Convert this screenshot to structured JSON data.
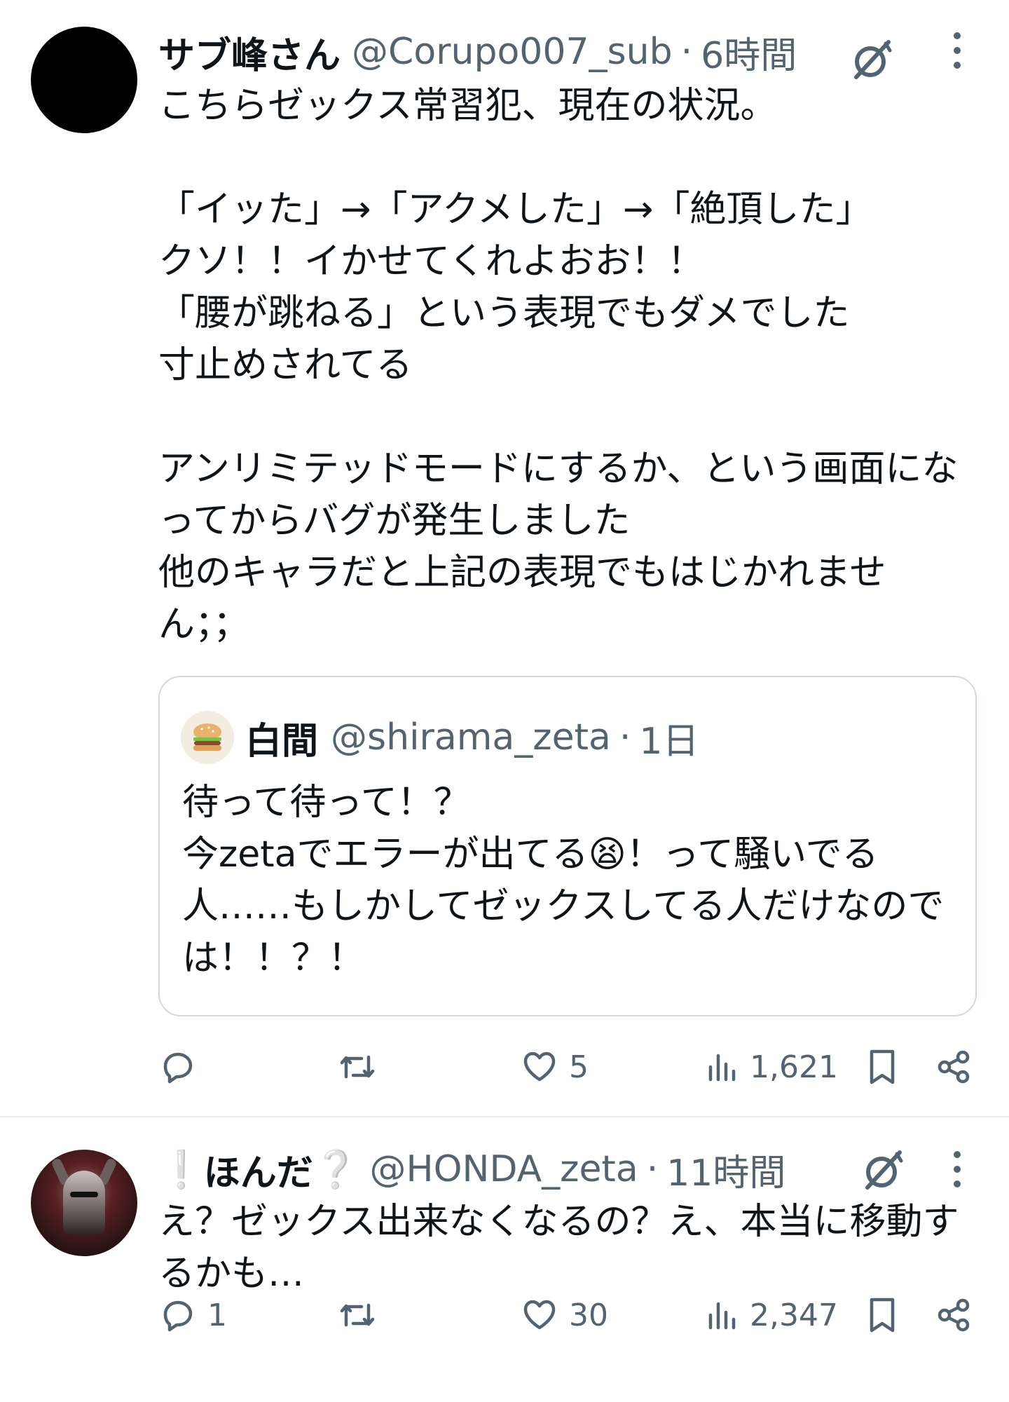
{
  "posts": [
    {
      "author_name": "サブ峰さん",
      "handle": "@Corupo007_sub",
      "separator": "·",
      "time": "6時間",
      "text": "こちらゼックス常習犯、現在の状況。\n\n「イッた」→「アクメした」→「絶頂した」\nクソ！！イかせてくれよおお！！\n「腰が跳ねる」という表現でもダメでした\n寸止めされてる\n\nアンリミテッドモードにするか、という画面にな\nってからバグが発生しました\n他のキャラだと上記の表現でもはじかれませ\nん；；",
      "quote": {
        "author_name": "白間",
        "handle": "@shirama_zeta",
        "separator": "·",
        "time": "1日",
        "text": "待って待って！？\n今zetaでエラーが出てる😫！って騒いでる\n人……もしかしてゼックスしてる人だけなので\nは！！？！",
        "avatar_icon": "hamburger-icon"
      },
      "actions": {
        "reply_count": "",
        "repost_count": "",
        "like_count": "5",
        "views_count": "1,621"
      }
    },
    {
      "author_name": "ほんだ",
      "name_prefix": "❕",
      "name_suffix": "❔",
      "handle": "@HONDA_zeta",
      "separator": "·",
      "time": "11時間",
      "text": "え？ゼックス出来なくなるの？え、本当に移動す\nるかも…",
      "actions": {
        "reply_count": "1",
        "repost_count": "",
        "like_count": "30",
        "views_count": "2,347"
      }
    }
  ],
  "colors": {
    "text_primary": "#0f1419",
    "text_secondary": "#536471",
    "border": "#cfd9de",
    "divider": "#e8ecef"
  },
  "icons": [
    "grok-icon",
    "more-icon",
    "reply-icon",
    "repost-icon",
    "like-icon",
    "views-icon",
    "bookmark-icon",
    "share-icon"
  ]
}
